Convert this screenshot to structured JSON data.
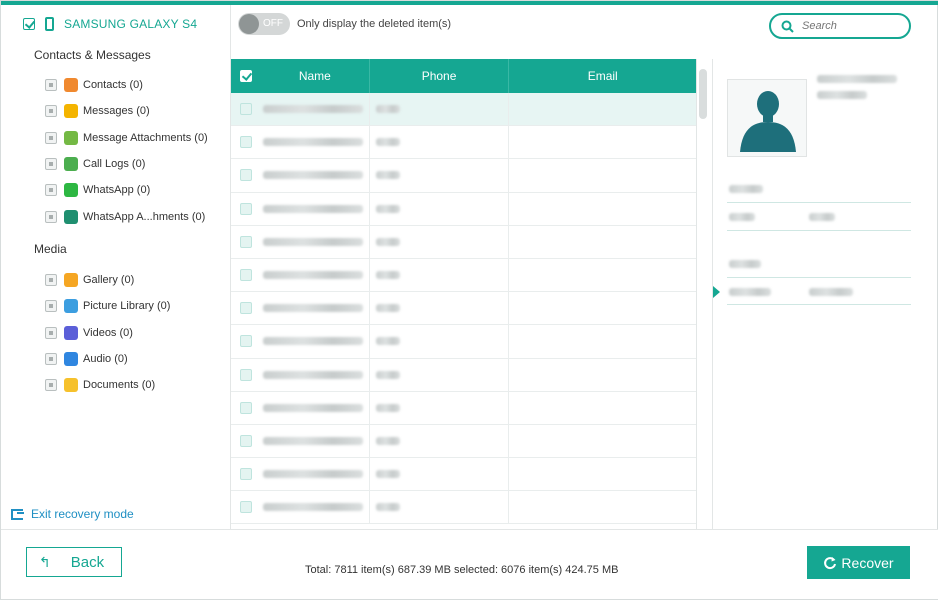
{
  "device": {
    "name": "SAMSUNG GALAXY S4"
  },
  "sidebar": {
    "contacts_messages_title": "Contacts & Messages",
    "media_title": "Media",
    "contacts_items": [
      {
        "label": "Contacts (0)",
        "icon": "contacts-icon",
        "color": "#f0892f"
      },
      {
        "label": "Messages (0)",
        "icon": "messages-icon",
        "color": "#f4b400"
      },
      {
        "label": "Message Attachments (0)",
        "icon": "attachment-icon",
        "color": "#74b944"
      },
      {
        "label": "Call Logs (0)",
        "icon": "call-logs-icon",
        "color": "#4cae4f"
      },
      {
        "label": "WhatsApp (0)",
        "icon": "whatsapp-icon",
        "color": "#2db742"
      },
      {
        "label": "WhatsApp A...hments (0)",
        "icon": "whatsapp-attachments-icon",
        "color": "#1f8f70"
      }
    ],
    "media_items": [
      {
        "label": "Gallery (0)",
        "icon": "gallery-icon",
        "color": "#f5a623"
      },
      {
        "label": "Picture Library (0)",
        "icon": "picture-library-icon",
        "color": "#3c9ee0"
      },
      {
        "label": "Videos (0)",
        "icon": "videos-icon",
        "color": "#5b5fd8"
      },
      {
        "label": "Audio (0)",
        "icon": "audio-icon",
        "color": "#2f86e0"
      },
      {
        "label": "Documents (0)",
        "icon": "documents-icon",
        "color": "#f6c12c"
      }
    ],
    "exit_label": "Exit recovery mode"
  },
  "toolbar": {
    "toggle_state": "OFF",
    "toggle_label": "Only display the deleted item(s)",
    "search_placeholder": "Search"
  },
  "table": {
    "columns": [
      "Name",
      "Phone",
      "Email"
    ],
    "row_count": 13,
    "selected_row": 0
  },
  "footer": {
    "back_label": "Back",
    "totals": "Total: 7811 item(s) 687.39 MB   selected: 6076 item(s) 424.75 MB",
    "recover_label": "Recover"
  },
  "colors": {
    "accent": "#15a792",
    "link": "#1f8fc3"
  }
}
